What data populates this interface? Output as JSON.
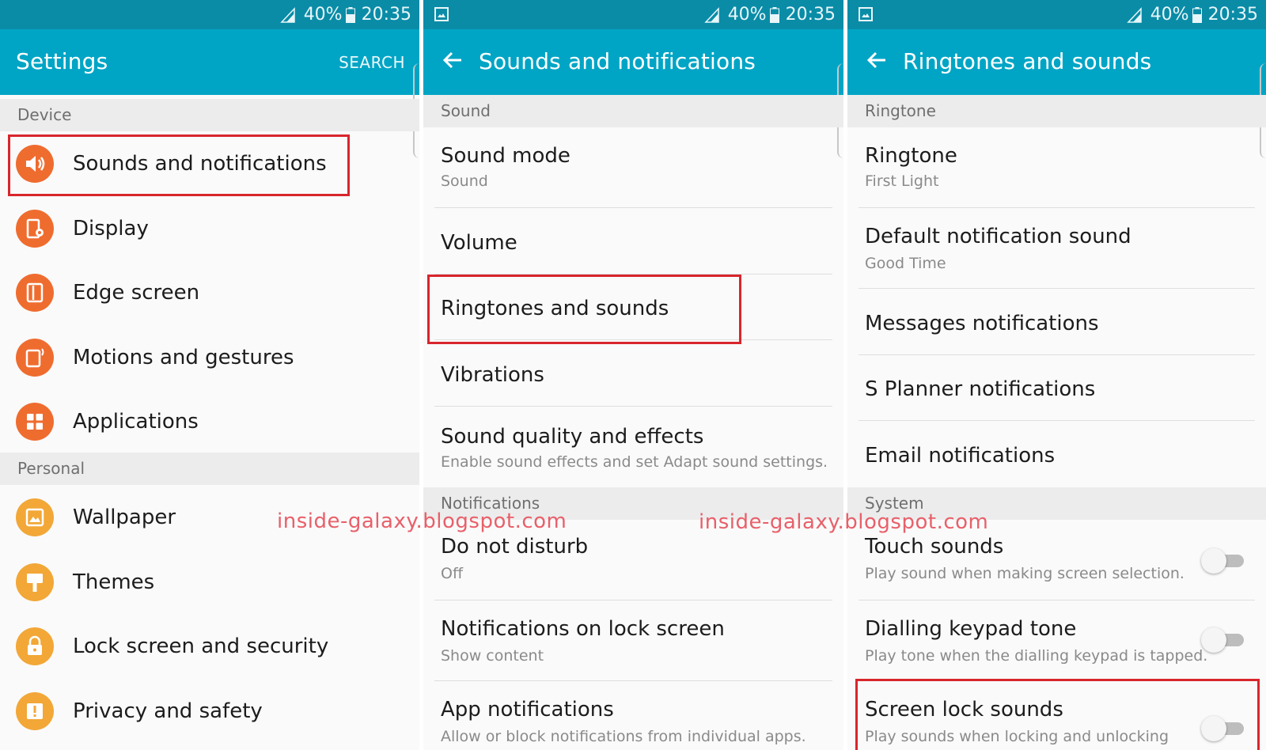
{
  "status": {
    "battery": "40%",
    "time": "20:35"
  },
  "panel1": {
    "title": "Settings",
    "search": "SEARCH",
    "sections": {
      "device": "Device",
      "personal": "Personal"
    },
    "device_items": [
      {
        "label": "Sounds and notifications",
        "icon": "speaker-icon",
        "color": "#ef6c2f"
      },
      {
        "label": "Display",
        "icon": "display-icon",
        "color": "#ef6c2f"
      },
      {
        "label": "Edge screen",
        "icon": "edge-screen-icon",
        "color": "#ef6c2f"
      },
      {
        "label": "Motions and gestures",
        "icon": "motion-icon",
        "color": "#ef6c2f"
      },
      {
        "label": "Applications",
        "icon": "applications-icon",
        "color": "#ef6c2f"
      }
    ],
    "personal_items": [
      {
        "label": "Wallpaper",
        "icon": "wallpaper-icon",
        "color": "#f2a737"
      },
      {
        "label": "Themes",
        "icon": "themes-icon",
        "color": "#f2a737"
      },
      {
        "label": "Lock screen and security",
        "icon": "lock-icon",
        "color": "#f2a737"
      },
      {
        "label": "Privacy and safety",
        "icon": "privacy-icon",
        "color": "#f2a737"
      }
    ]
  },
  "panel2": {
    "title": "Sounds and notifications",
    "sections": {
      "sound": "Sound",
      "notifications": "Notifications"
    },
    "items": {
      "sound_mode": {
        "title": "Sound mode",
        "subtitle": "Sound"
      },
      "volume": {
        "title": "Volume"
      },
      "ringtones": {
        "title": "Ringtones and sounds"
      },
      "vibrations": {
        "title": "Vibrations"
      },
      "sound_quality": {
        "title": "Sound quality and effects",
        "subtitle": "Enable sound effects and set Adapt sound settings."
      },
      "dnd": {
        "title": "Do not disturb",
        "subtitle": "Off"
      },
      "lockscreen": {
        "title": "Notifications on lock screen",
        "subtitle": "Show content"
      },
      "app_notif": {
        "title": "App notifications",
        "subtitle": "Allow or block notifications from individual apps."
      }
    }
  },
  "panel3": {
    "title": "Ringtones and sounds",
    "sections": {
      "ringtone": "Ringtone",
      "system": "System"
    },
    "items": {
      "ringtone": {
        "title": "Ringtone",
        "subtitle": "First Light"
      },
      "default_notif": {
        "title": "Default notification sound",
        "subtitle": "Good Time"
      },
      "messages": {
        "title": "Messages notifications"
      },
      "splanner": {
        "title": "S Planner notifications"
      },
      "email": {
        "title": "Email notifications"
      },
      "touch": {
        "title": "Touch sounds",
        "subtitle": "Play sound when making screen selection.",
        "on": false
      },
      "dialling": {
        "title": "Dialling keypad tone",
        "subtitle": "Play tone when the dialling keypad is tapped.",
        "on": false
      },
      "screenlock": {
        "title": "Screen lock sounds",
        "subtitle": "Play sounds when locking and unlocking",
        "on": false
      }
    }
  },
  "watermark": "inside-galaxy.blogspot.com",
  "colors": {
    "statusbar": "#0a8ca7",
    "appbar": "#00a5c5",
    "highlight": "#d8262c",
    "watermark": "#e8606a"
  }
}
